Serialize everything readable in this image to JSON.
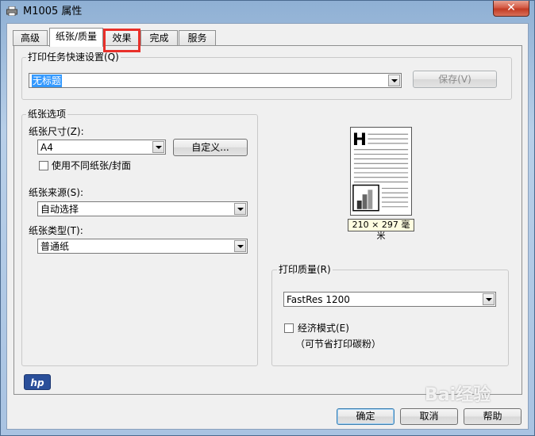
{
  "window": {
    "title": "M1005 属性",
    "close_symbol": "✕"
  },
  "tabs": [
    {
      "label": "高级"
    },
    {
      "label": "纸张/质量"
    },
    {
      "label": "效果"
    },
    {
      "label": "完成"
    },
    {
      "label": "服务"
    }
  ],
  "quick_set": {
    "group_label": "打印任务快速设置(Q)",
    "value": "无标题",
    "save_label": "保存(V)"
  },
  "paper_options": {
    "group_label": "纸张选项",
    "size_label": "纸张尺寸(Z):",
    "size_value": "A4",
    "custom_label": "自定义...",
    "diff_paper_label": "使用不同纸张/封面",
    "source_label": "纸张来源(S):",
    "source_value": "自动选择",
    "type_label": "纸张类型(T):",
    "type_value": "普通纸"
  },
  "preview": {
    "size_text": "210 × 297 毫米"
  },
  "quality": {
    "group_label": "打印质量(R)",
    "value": "FastRes 1200",
    "economode_label": "经济模式(E)",
    "economode_note": "（可节省打印碳粉）"
  },
  "brand": {
    "logo_text": "hp"
  },
  "footer": {
    "ok_label": "确定",
    "cancel_label": "取消",
    "help_label": "帮助"
  },
  "watermark": "Bai经验",
  "colors": {
    "accent": "#3399ff",
    "highlight_box": "#e8302a"
  }
}
